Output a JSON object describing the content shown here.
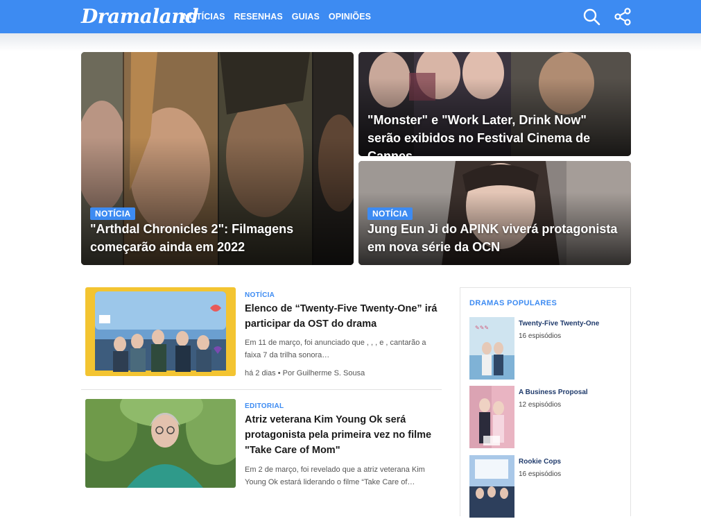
{
  "header": {
    "logo": "Dramaland",
    "nav": [
      "NOTÍCIAS",
      "RESENHAS",
      "GUIAS",
      "OPINIÕES"
    ],
    "icons": [
      "search-icon",
      "share-icon"
    ],
    "accent": "#3d8bf2"
  },
  "hero": {
    "main": {
      "tag": "NOTÍCIA",
      "title": "\"Arthdal Chronicles 2\": Filmagens começarão ainda em 2022"
    },
    "top_right": {
      "title": "\"Monster\" e \"Work Later, Drink Now\" serão exibidos no Festival Cinema de Cannes"
    },
    "bottom_right": {
      "tag": "NOTÍCIA",
      "title": "Jung Eun Ji do APINK viverá protagonista em nova série da OCN"
    }
  },
  "articles": [
    {
      "category": "NOTÍCIA",
      "title": "Elenco de “Twenty-Five Twenty-One” irá participar da OST do drama",
      "excerpt": "Em 11 de março, foi anunciado que , , , e , cantarão a faixa 7 da trilha sonora…",
      "meta": "há 2 dias • Por Guilherme S. Sousa"
    },
    {
      "category": "EDITORIAL",
      "title": "Atriz veterana Kim Young Ok será protagonista pela primeira vez no filme \"Take Care of Mom\"",
      "excerpt": "Em 2 de março, foi revelado que a atriz veterana Kim Young Ok estará liderando o filme “Take Care of…"
    }
  ],
  "sidebar": {
    "heading": "DRAMAS POPULARES",
    "items": [
      {
        "title": "Twenty-Five Twenty-One",
        "episodes": "16 espisódios"
      },
      {
        "title": "A Business Proposal",
        "episodes": "12 espisódios"
      },
      {
        "title": "Rookie Cops",
        "episodes": "16 espisódios"
      }
    ]
  }
}
